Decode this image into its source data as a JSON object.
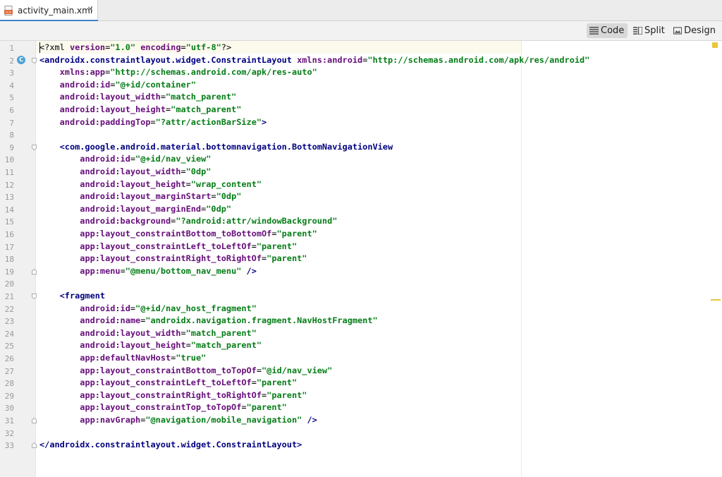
{
  "tab": {
    "filename": "activity_main.xml",
    "close_glyph": "✕",
    "icon": "xml-file-icon"
  },
  "toolbar": {
    "code_label": "Code",
    "split_label": "Split",
    "design_label": "Design",
    "active": "Code"
  },
  "gutter": {
    "line_numbers": [
      "1",
      "2",
      "3",
      "4",
      "5",
      "6",
      "7",
      "8",
      "9",
      "10",
      "11",
      "12",
      "13",
      "14",
      "15",
      "16",
      "17",
      "18",
      "19",
      "20",
      "21",
      "22",
      "23",
      "24",
      "25",
      "26",
      "27",
      "28",
      "29",
      "30",
      "31",
      "32",
      "33"
    ],
    "class_badge": "C"
  },
  "code_lines": [
    [
      [
        "pi",
        "<?xml "
      ],
      [
        "an",
        "version"
      ],
      [
        "pun",
        "="
      ],
      [
        "av",
        "\"1.0\""
      ],
      [
        "pun",
        " "
      ],
      [
        "an",
        "encoding"
      ],
      [
        "pun",
        "="
      ],
      [
        "av",
        "\"utf-8\""
      ],
      [
        "pi",
        "?>"
      ]
    ],
    [
      [
        "tag",
        "<androidx.constraintlayout.widget.ConstraintLayout "
      ],
      [
        "an",
        "xmlns:android"
      ],
      [
        "pun",
        "="
      ],
      [
        "av",
        "\"http://schemas.android.com/apk/res/android\""
      ]
    ],
    [
      [
        "pun",
        "    "
      ],
      [
        "an",
        "xmlns:app"
      ],
      [
        "pun",
        "="
      ],
      [
        "av",
        "\"http://schemas.android.com/apk/res-auto\""
      ]
    ],
    [
      [
        "pun",
        "    "
      ],
      [
        "an",
        "android:id"
      ],
      [
        "pun",
        "="
      ],
      [
        "av",
        "\"@+id/container\""
      ]
    ],
    [
      [
        "pun",
        "    "
      ],
      [
        "an",
        "android:layout_width"
      ],
      [
        "pun",
        "="
      ],
      [
        "av",
        "\"match_parent\""
      ]
    ],
    [
      [
        "pun",
        "    "
      ],
      [
        "an",
        "android:layout_height"
      ],
      [
        "pun",
        "="
      ],
      [
        "av",
        "\"match_parent\""
      ]
    ],
    [
      [
        "pun",
        "    "
      ],
      [
        "an",
        "android:paddingTop"
      ],
      [
        "pun",
        "="
      ],
      [
        "av",
        "\"?attr/actionBarSize\""
      ],
      [
        "tag",
        ">"
      ]
    ],
    [],
    [
      [
        "pun",
        "    "
      ],
      [
        "tag",
        "<com.google.android.material.bottomnavigation.BottomNavigationView"
      ]
    ],
    [
      [
        "pun",
        "        "
      ],
      [
        "an",
        "android:id"
      ],
      [
        "pun",
        "="
      ],
      [
        "av",
        "\"@+id/nav_view\""
      ]
    ],
    [
      [
        "pun",
        "        "
      ],
      [
        "an",
        "android:layout_width"
      ],
      [
        "pun",
        "="
      ],
      [
        "av",
        "\"0dp\""
      ]
    ],
    [
      [
        "pun",
        "        "
      ],
      [
        "an",
        "android:layout_height"
      ],
      [
        "pun",
        "="
      ],
      [
        "av",
        "\"wrap_content\""
      ]
    ],
    [
      [
        "pun",
        "        "
      ],
      [
        "an",
        "android:layout_marginStart"
      ],
      [
        "pun",
        "="
      ],
      [
        "av",
        "\"0dp\""
      ]
    ],
    [
      [
        "pun",
        "        "
      ],
      [
        "an",
        "android:layout_marginEnd"
      ],
      [
        "pun",
        "="
      ],
      [
        "av",
        "\"0dp\""
      ]
    ],
    [
      [
        "pun",
        "        "
      ],
      [
        "an",
        "android:background"
      ],
      [
        "pun",
        "="
      ],
      [
        "av",
        "\"?android:attr/windowBackground\""
      ]
    ],
    [
      [
        "pun",
        "        "
      ],
      [
        "an",
        "app:layout_constraintBottom_toBottomOf"
      ],
      [
        "pun",
        "="
      ],
      [
        "av",
        "\"parent\""
      ]
    ],
    [
      [
        "pun",
        "        "
      ],
      [
        "an",
        "app:layout_constraintLeft_toLeftOf"
      ],
      [
        "pun",
        "="
      ],
      [
        "av",
        "\"parent\""
      ]
    ],
    [
      [
        "pun",
        "        "
      ],
      [
        "an",
        "app:layout_constraintRight_toRightOf"
      ],
      [
        "pun",
        "="
      ],
      [
        "av",
        "\"parent\""
      ]
    ],
    [
      [
        "pun",
        "        "
      ],
      [
        "an",
        "app:menu"
      ],
      [
        "pun",
        "="
      ],
      [
        "av",
        "\"@menu/bottom_nav_menu\""
      ],
      [
        "tag",
        " />"
      ]
    ],
    [],
    [
      [
        "pun",
        "    "
      ],
      [
        "tag",
        "<fragment"
      ]
    ],
    [
      [
        "pun",
        "        "
      ],
      [
        "an",
        "android:id"
      ],
      [
        "pun",
        "="
      ],
      [
        "av",
        "\"@+id/nav_host_fragment\""
      ]
    ],
    [
      [
        "pun",
        "        "
      ],
      [
        "an",
        "android:name"
      ],
      [
        "pun",
        "="
      ],
      [
        "av",
        "\"androidx.navigation.fragment.NavHostFragment\""
      ]
    ],
    [
      [
        "pun",
        "        "
      ],
      [
        "an",
        "android:layout_width"
      ],
      [
        "pun",
        "="
      ],
      [
        "av",
        "\"match_parent\""
      ]
    ],
    [
      [
        "pun",
        "        "
      ],
      [
        "an",
        "android:layout_height"
      ],
      [
        "pun",
        "="
      ],
      [
        "av",
        "\"match_parent\""
      ]
    ],
    [
      [
        "pun",
        "        "
      ],
      [
        "an",
        "app:defaultNavHost"
      ],
      [
        "pun",
        "="
      ],
      [
        "av",
        "\"true\""
      ]
    ],
    [
      [
        "pun",
        "        "
      ],
      [
        "an",
        "app:layout_constraintBottom_toTopOf"
      ],
      [
        "pun",
        "="
      ],
      [
        "av",
        "\"@id/nav_view\""
      ]
    ],
    [
      [
        "pun",
        "        "
      ],
      [
        "an",
        "app:layout_constraintLeft_toLeftOf"
      ],
      [
        "pun",
        "="
      ],
      [
        "av",
        "\"parent\""
      ]
    ],
    [
      [
        "pun",
        "        "
      ],
      [
        "an",
        "app:layout_constraintRight_toRightOf"
      ],
      [
        "pun",
        "="
      ],
      [
        "av",
        "\"parent\""
      ]
    ],
    [
      [
        "pun",
        "        "
      ],
      [
        "an",
        "app:layout_constraintTop_toTopOf"
      ],
      [
        "pun",
        "="
      ],
      [
        "av",
        "\"parent\""
      ]
    ],
    [
      [
        "pun",
        "        "
      ],
      [
        "an",
        "app:navGraph"
      ],
      [
        "pun",
        "="
      ],
      [
        "av",
        "\"@navigation/mobile_navigation\""
      ],
      [
        "tag",
        " />"
      ]
    ],
    [],
    [
      [
        "tag",
        "</androidx.constraintlayout.widget.ConstraintLayout>"
      ]
    ]
  ],
  "fold_lines": [
    "2",
    "9",
    "19",
    "21",
    "31",
    "33"
  ],
  "colors": {
    "tag": "#000080",
    "attribute_name": "#660e7a",
    "attribute_value": "#067d17",
    "accent": "#4083c9",
    "warning_marker": "#e8c73a"
  }
}
